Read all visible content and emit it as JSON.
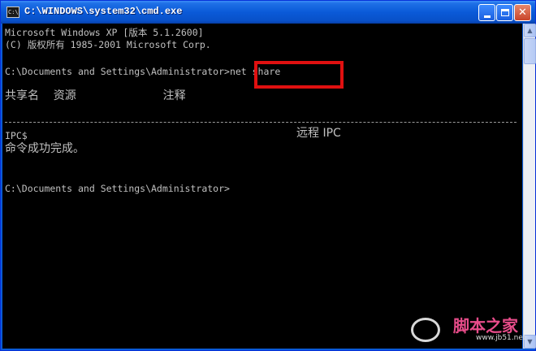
{
  "window": {
    "title": "C:\\WINDOWS\\system32\\cmd.exe",
    "icon_label": "C:\\",
    "minimize_glyph": "",
    "close_glyph": "✕"
  },
  "console": {
    "lines": [
      "Microsoft Windows XP [版本 5.1.2600]",
      "(C) 版权所有 1985-2001 Microsoft Corp.",
      "C:\\Documents and Settings\\Administrator>net share",
      "共享名    资源                        注释",
      "IPC$",
      "远程 IPC",
      "命令成功完成。",
      "C:\\Documents and Settings\\Administrator>"
    ],
    "highlighted_command": "net share"
  },
  "colors": {
    "console_bg": "#000000",
    "console_text": "#c0c0c0",
    "highlight": "#e01010",
    "titlebar": "#0a5ad8"
  },
  "watermark": {
    "brand": "脚本之家",
    "site": "www.jb51.net"
  }
}
